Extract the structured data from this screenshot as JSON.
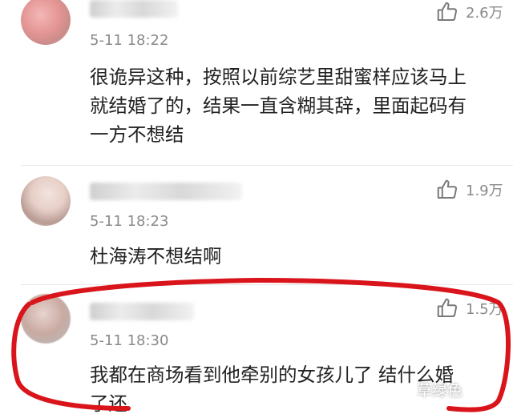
{
  "comments": [
    {
      "time": "5-11 18:22",
      "likes": "2.6万",
      "text": "很诡异这种，按照以前综艺里甜蜜样应该马上\n就结婚了的，结果一直含糊其辞，里面起码有\n一方不想结"
    },
    {
      "time": "5-11 18:23",
      "likes": "1.9万",
      "text": "杜海涛不想结啊"
    },
    {
      "time": "5-11 18:30",
      "likes": "1.5万",
      "text": "我都在商场看到他牵别的女孩儿了 结什么婚\n了还"
    }
  ],
  "watermark": "草绿色",
  "colors": {
    "highlight_circle": "#d9141b",
    "muted_text": "#8a8a8a"
  },
  "icons": {
    "like": "thumbs-up-icon"
  }
}
